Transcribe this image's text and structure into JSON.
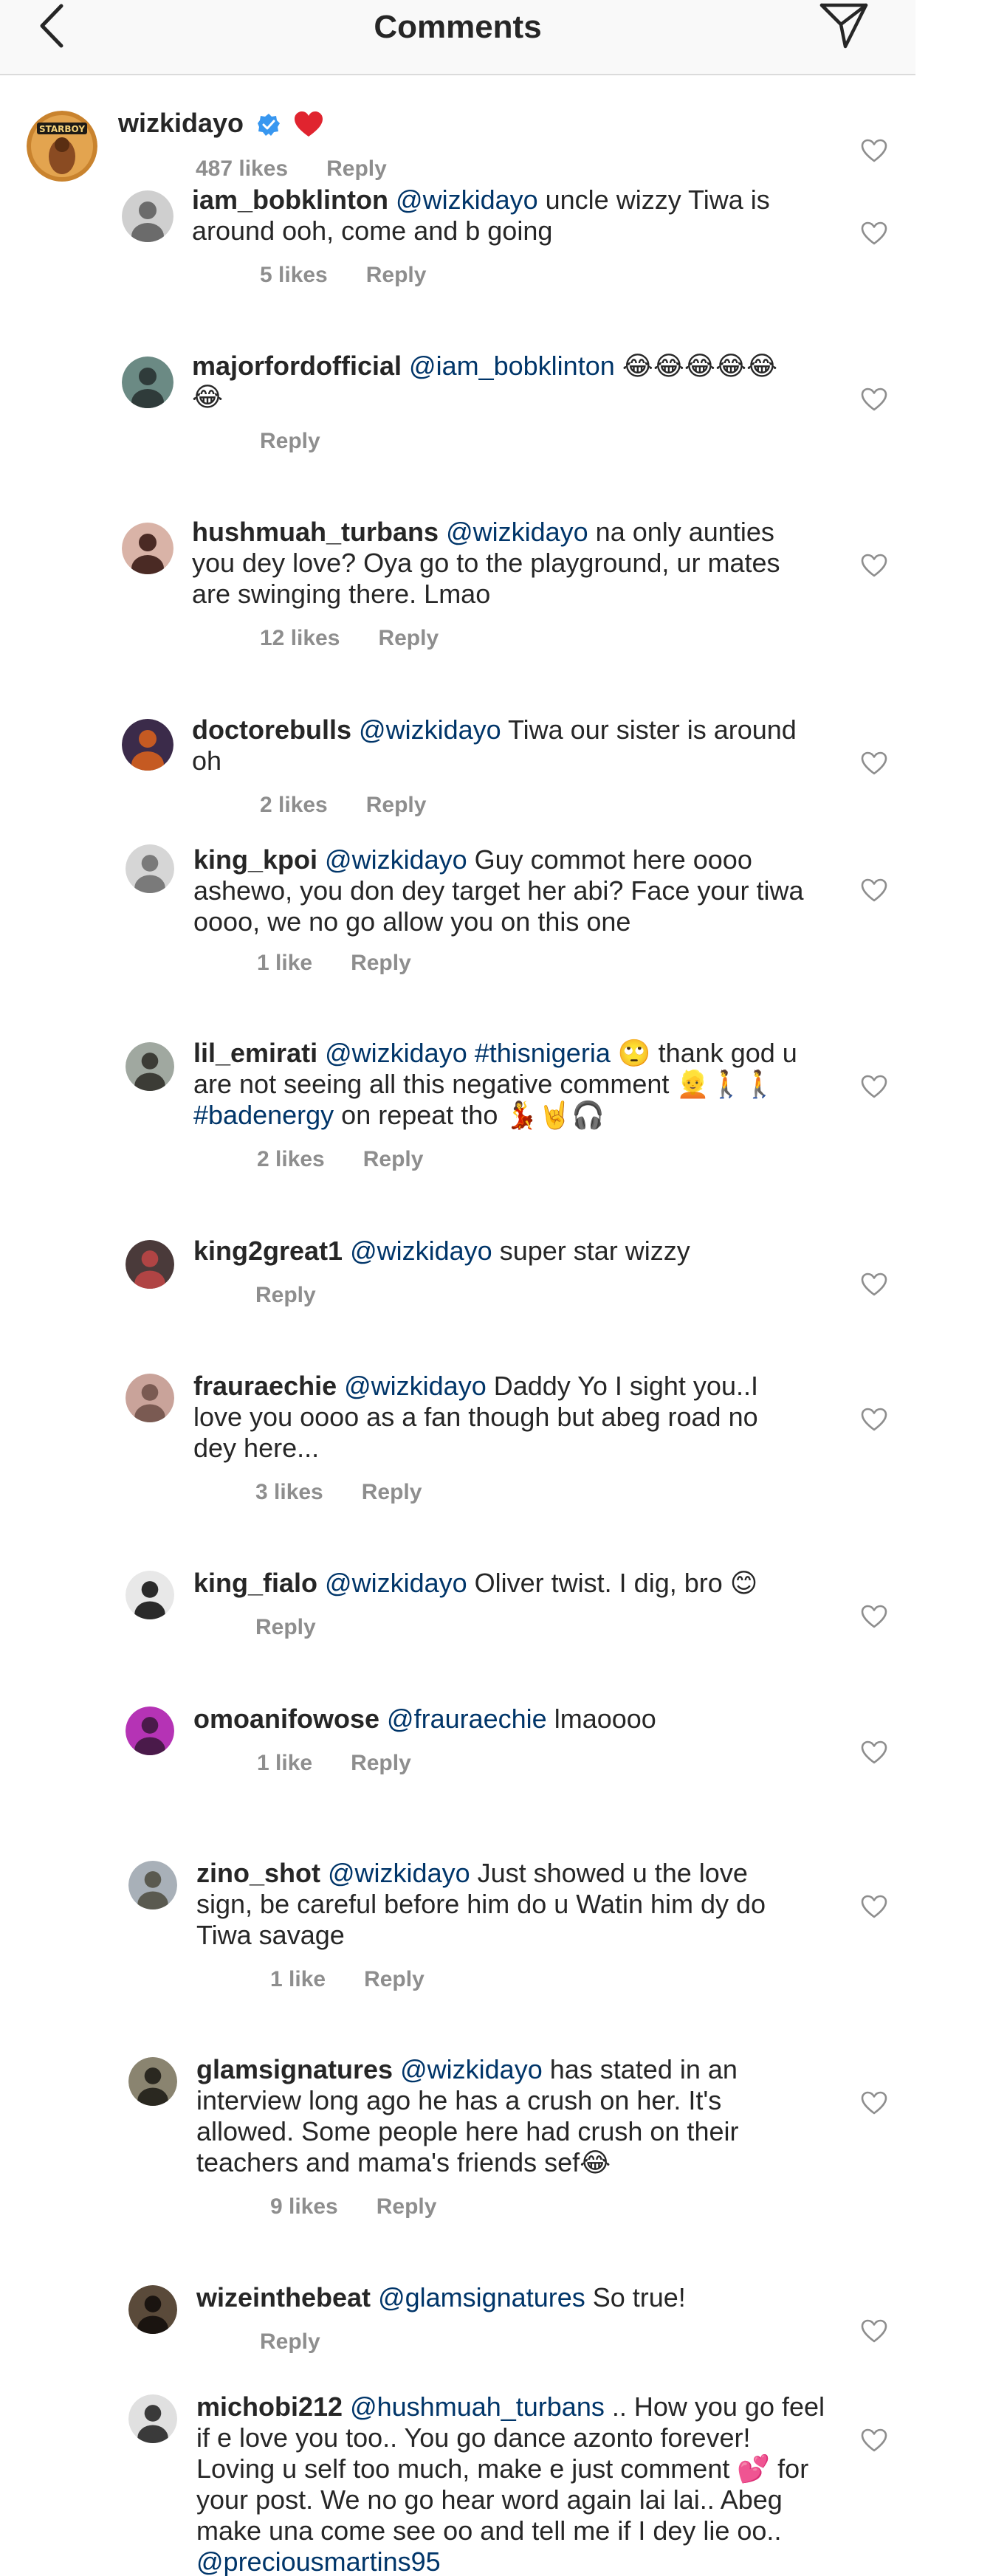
{
  "header": {
    "title": "Comments"
  },
  "colors": {
    "mention": "#003569",
    "meta": "#8e8e8e",
    "heart": "#ed4956",
    "verified": "#3897f0"
  },
  "top_comment": {
    "username": "wizkidayo",
    "likes": "487 likes",
    "reply": "Reply"
  },
  "replies": [
    {
      "username": "iam_bobklinton",
      "mention": "@wizkidayo",
      "text": " uncle wizzy Tiwa is around ooh, come and b going",
      "likes": "5 likes",
      "reply": "Reply"
    },
    {
      "username": "majorfordofficial",
      "mention": "@iam_bobklinton",
      "text": " 😂😂😂😂😂😂",
      "likes": "",
      "reply": "Reply"
    },
    {
      "username": "hushmuah_turbans",
      "mention": "@wizkidayo",
      "text": " na only aunties you dey love? Oya go to the playground, ur mates are swinging there. Lmao",
      "likes": "12 likes",
      "reply": "Reply"
    },
    {
      "username": "doctorebulls",
      "mention": "@wizkidayo",
      "text": " Tiwa our sister is around oh",
      "likes": "2 likes",
      "reply": "Reply"
    },
    {
      "username": "king_kpoi",
      "mention": "@wizkidayo",
      "text": " Guy commot here oooo ashewo, you don dey target her abi? Face your tiwa oooo, we no go allow you on this one",
      "likes": "1 like",
      "reply": "Reply"
    },
    {
      "username": "lil_emirati",
      "mention": "@wizkidayo",
      "hashtag1": " #thisnigeria",
      "text": " 🙄 thank god u are not seeing all this negative comment 👱🚶🚶 ",
      "hashtag2": "#badenergy",
      "text2": " on repeat tho 💃🤘🎧",
      "likes": "2 likes",
      "reply": "Reply"
    },
    {
      "username": "king2great1",
      "mention": "@wizkidayo",
      "text": " super star wizzy",
      "likes": "",
      "reply": "Reply"
    },
    {
      "username": "frauraechie",
      "mention": "@wizkidayo",
      "text": " Daddy Yo I sight you..I love you oooo as a fan though but abeg road no dey here...",
      "likes": "3 likes",
      "reply": "Reply"
    },
    {
      "username": "king_fialo",
      "mention": "@wizkidayo",
      "text": " Oliver twist. I dig, bro 😊",
      "likes": "",
      "reply": "Reply"
    },
    {
      "username": "omoanifowose",
      "mention": "@frauraechie",
      "text": " lmaoooo",
      "likes": "1 like",
      "reply": "Reply"
    },
    {
      "username": "zino_shot",
      "mention": "@wizkidayo",
      "text": " Just showed u the love sign,  be careful before him do u Watin him dy do Tiwa savage",
      "likes": "1 like",
      "reply": "Reply"
    },
    {
      "username": "glamsignatures",
      "mention": "@wizkidayo",
      "text": "  has stated in an interview long ago he has a crush on her. It's allowed. Some people here had crush on their teachers and mama's friends sef😂",
      "likes": "9 likes",
      "reply": "Reply"
    },
    {
      "username": "wizeinthebeat",
      "mention": "@glamsignatures",
      "text": " So true!",
      "likes": "",
      "reply": "Reply"
    },
    {
      "username": "michobi212",
      "mention": "@hushmuah_turbans",
      "text": " .. How you go feel if e love you too.. You go dance azonto forever! Loving u self too much, make e just comment 💕  for your post. We no go hear word again lai lai.. Abeg make una come see oo and tell me if I dey lie oo.. ",
      "mention2": "@preciousmartins95",
      "likes": "",
      "reply": ""
    }
  ]
}
